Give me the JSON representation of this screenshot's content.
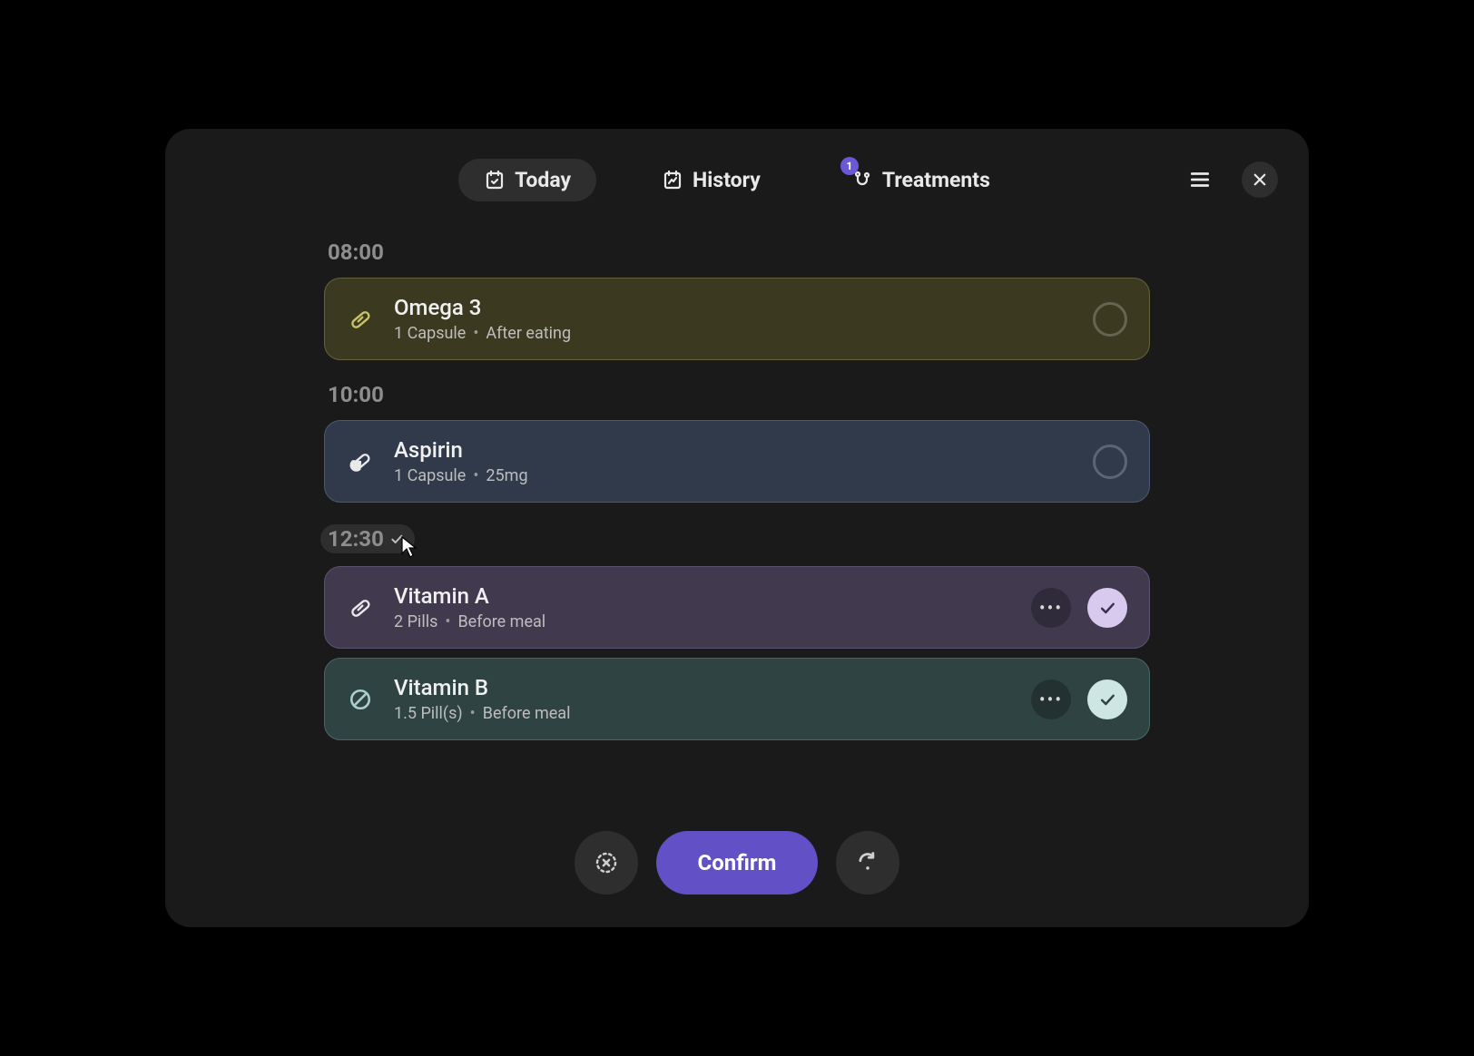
{
  "tabs": {
    "today": {
      "label": "Today"
    },
    "history": {
      "label": "History"
    },
    "treatments": {
      "label": "Treatments",
      "badge": "1"
    }
  },
  "slots": [
    {
      "time": "08:00",
      "marked": false,
      "items": [
        {
          "color": "yellow",
          "icon": "capsule-outline",
          "name": "Omega 3",
          "dose": "1 Capsule",
          "note": "After eating",
          "state": "unchecked"
        }
      ]
    },
    {
      "time": "10:00",
      "marked": false,
      "items": [
        {
          "color": "blue",
          "icon": "capsule-solid",
          "name": "Aspirin",
          "dose": "1 Capsule",
          "note": "25mg",
          "state": "unchecked"
        }
      ]
    },
    {
      "time": "12:30",
      "marked": true,
      "items": [
        {
          "color": "purple",
          "icon": "capsule-outline",
          "name": "Vitamin A",
          "dose": "2 Pills",
          "note": "Before meal",
          "state": "checked"
        },
        {
          "color": "teal",
          "icon": "slash-circle",
          "name": "Vitamin B",
          "dose": "1.5 Pill(s)",
          "note": "Before meal",
          "state": "checked"
        }
      ]
    }
  ],
  "footer": {
    "confirm": "Confirm"
  }
}
